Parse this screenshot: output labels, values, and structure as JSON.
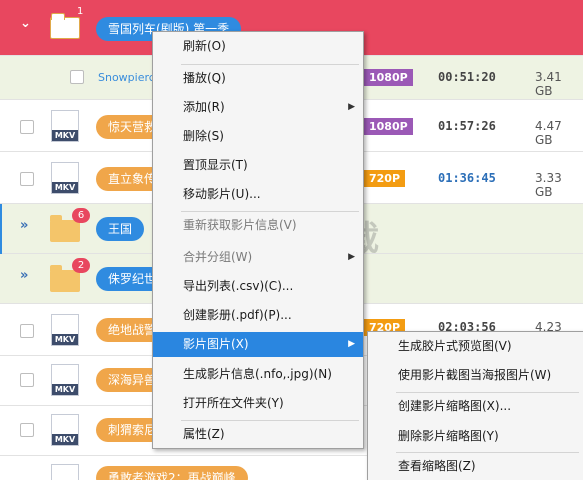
{
  "rows": [
    {
      "kind": "header",
      "expander": "⌄",
      "folder_count": "1",
      "title": "雪国列车(剧版) 第一季"
    },
    {
      "kind": "sub",
      "title": "Snowpiercer",
      "resolution": "1080P",
      "duration": "00:51:20",
      "size": "3.41 GB"
    },
    {
      "kind": "file",
      "format": "MKV",
      "title": "惊天营救",
      "resolution": "1080P",
      "duration": "01:57:26",
      "size": "4.47 GB"
    },
    {
      "kind": "file",
      "format": "MKV",
      "title": "直立象传",
      "resolution": "720P",
      "duration": "01:36:45",
      "size": "3.33 GB"
    },
    {
      "kind": "group",
      "expander": "»",
      "folder_count": "6",
      "title": "王国"
    },
    {
      "kind": "group",
      "expander": "»",
      "folder_count": "2",
      "title": "侏罗纪世"
    },
    {
      "kind": "file",
      "format": "MKV",
      "title": "绝地战警",
      "resolution": "720P",
      "duration": "02:03:56",
      "size": "4.23 GB"
    },
    {
      "kind": "file",
      "format": "MKV",
      "title": "深海异兽"
    },
    {
      "kind": "file",
      "format": "MKV",
      "title": "刺猬索尼"
    },
    {
      "kind": "file",
      "format": "",
      "title": "勇敢者游戏2：再战巅峰"
    }
  ],
  "context_menu": {
    "items": [
      {
        "label": "刷新(O)",
        "disabled": false,
        "submenu": false
      },
      {
        "label": "播放(Q)",
        "disabled": false,
        "submenu": false
      },
      {
        "label": "添加(R)",
        "disabled": false,
        "submenu": true
      },
      {
        "label": "删除(S)",
        "disabled": false,
        "submenu": false
      },
      {
        "label": "置顶显示(T)",
        "disabled": false,
        "submenu": false
      },
      {
        "label": "移动影片(U)...",
        "disabled": false,
        "submenu": false
      },
      {
        "label": "重新获取影片信息(V)",
        "disabled": true,
        "submenu": false
      },
      {
        "label": "合并分组(W)",
        "disabled": true,
        "submenu": true
      },
      {
        "label": "导出列表(.csv)(C)...",
        "disabled": false,
        "submenu": false
      },
      {
        "label": "创建影册(.pdf)(P)...",
        "disabled": false,
        "submenu": false
      },
      {
        "label": "影片图片(X)",
        "disabled": false,
        "submenu": true,
        "selected": true
      },
      {
        "label": "生成影片信息(.nfo,.jpg)(N)",
        "disabled": false,
        "submenu": false
      },
      {
        "label": "打开所在文件夹(Y)",
        "disabled": false,
        "submenu": false
      },
      {
        "label": "属性(Z)",
        "disabled": false,
        "submenu": false
      }
    ]
  },
  "submenu": {
    "items": [
      {
        "label": "生成胶片式预览图(V)"
      },
      {
        "label": "使用影片截图当海报图片(W)"
      },
      {
        "label": "创建影片缩略图(X)..."
      },
      {
        "label": "删除影片缩略图(Y)"
      },
      {
        "label": "查看缩略图(Z)"
      }
    ]
  },
  "watermark": {
    "text": "安下载",
    "url": "anxz.com"
  },
  "colors": {
    "header_bg": "#e8475f",
    "sub_bg": "#eef3e3",
    "menu_selected": "#2a86e0",
    "badge_purple": "#9b59b6",
    "badge_orange": "#f39c12",
    "pill_orange": "#f0a64a",
    "pill_blue": "#2f8be0"
  }
}
